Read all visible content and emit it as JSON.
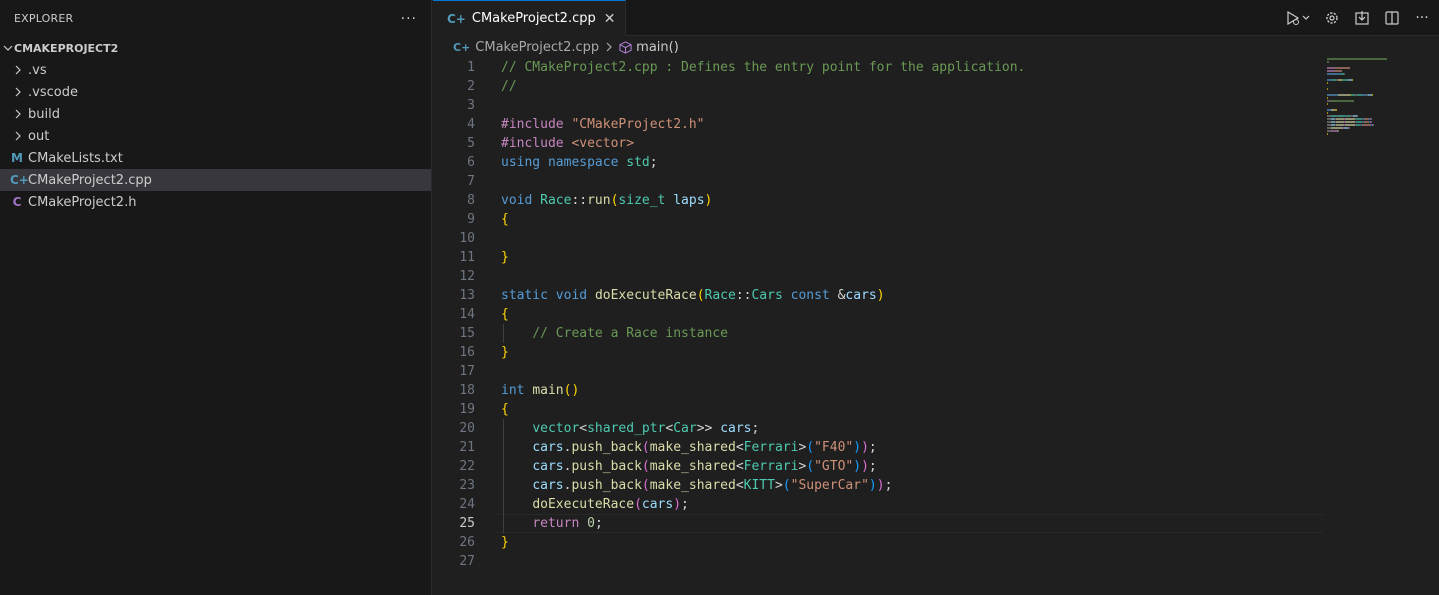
{
  "explorer": {
    "title": "EXPLORER",
    "more": "···",
    "project": "CMAKEPROJECT2",
    "items": [
      {
        "type": "folder",
        "label": ".vs"
      },
      {
        "type": "folder",
        "label": ".vscode"
      },
      {
        "type": "folder",
        "label": "build"
      },
      {
        "type": "folder",
        "label": "out"
      },
      {
        "type": "file",
        "icon": "M",
        "label": "CMakeLists.txt"
      },
      {
        "type": "file",
        "icon": "C+",
        "label": "CMakeProject2.cpp",
        "selected": true
      },
      {
        "type": "file",
        "icon": "C",
        "label": "CMakeProject2.h"
      }
    ]
  },
  "editor": {
    "tab": {
      "label": "CMakeProject2.cpp",
      "icon": "C+",
      "close": "✕"
    },
    "breadcrumb": {
      "file": "CMakeProject2.cpp",
      "symbol": "main()"
    },
    "current_line": 25,
    "lines": [
      [
        [
          "cm",
          "// CMakeProject2.cpp : Defines the entry point for the application."
        ]
      ],
      [
        [
          "cm",
          "//"
        ]
      ],
      [],
      [
        [
          "pp",
          "#include "
        ],
        [
          "st",
          "\"CMakeProject2.h\""
        ]
      ],
      [
        [
          "pp",
          "#include "
        ],
        [
          "st",
          "<vector>"
        ]
      ],
      [
        [
          "kw",
          "using "
        ],
        [
          "kw",
          "namespace "
        ],
        [
          "ty",
          "std"
        ],
        [
          "op",
          ";"
        ]
      ],
      [],
      [
        [
          "kw",
          "void "
        ],
        [
          "ty",
          "Race"
        ],
        [
          "op",
          "::"
        ],
        [
          "fn",
          "run"
        ],
        [
          "br1",
          "("
        ],
        [
          "ty",
          "size_t "
        ],
        [
          "va",
          "laps"
        ],
        [
          "br1",
          ")"
        ]
      ],
      [
        [
          "br1",
          "{"
        ]
      ],
      [],
      [
        [
          "br1",
          "}"
        ]
      ],
      [],
      [
        [
          "kw",
          "static "
        ],
        [
          "kw",
          "void "
        ],
        [
          "fn",
          "doExecuteRace"
        ],
        [
          "br1",
          "("
        ],
        [
          "ty",
          "Race"
        ],
        [
          "op",
          "::"
        ],
        [
          "ty",
          "Cars "
        ],
        [
          "kw",
          "const "
        ],
        [
          "op",
          "&"
        ],
        [
          "va",
          "cars"
        ],
        [
          "br1",
          ")"
        ]
      ],
      [
        [
          "br1",
          "{"
        ]
      ],
      [
        [
          "op",
          "    "
        ],
        [
          "cm",
          "// Create a Race instance"
        ]
      ],
      [
        [
          "br1",
          "}"
        ]
      ],
      [],
      [
        [
          "kw",
          "int "
        ],
        [
          "fn",
          "main"
        ],
        [
          "br1",
          "()"
        ]
      ],
      [
        [
          "br1",
          "{"
        ]
      ],
      [
        [
          "op",
          "    "
        ],
        [
          "ty",
          "vector"
        ],
        [
          "op",
          "<"
        ],
        [
          "ty",
          "shared_ptr"
        ],
        [
          "op",
          "<"
        ],
        [
          "ty",
          "Car"
        ],
        [
          "op",
          ">> "
        ],
        [
          "va",
          "cars"
        ],
        [
          "op",
          ";"
        ]
      ],
      [
        [
          "op",
          "    "
        ],
        [
          "va",
          "cars"
        ],
        [
          "op",
          "."
        ],
        [
          "fn",
          "push_back"
        ],
        [
          "br2",
          "("
        ],
        [
          "fn",
          "make_shared"
        ],
        [
          "op",
          "<"
        ],
        [
          "ty",
          "Ferrari"
        ],
        [
          "op",
          ">"
        ],
        [
          "br3",
          "("
        ],
        [
          "st",
          "\"F40\""
        ],
        [
          "br3",
          ")"
        ],
        [
          "br2",
          ")"
        ],
        [
          "op",
          ";"
        ]
      ],
      [
        [
          "op",
          "    "
        ],
        [
          "va",
          "cars"
        ],
        [
          "op",
          "."
        ],
        [
          "fn",
          "push_back"
        ],
        [
          "br2",
          "("
        ],
        [
          "fn",
          "make_shared"
        ],
        [
          "op",
          "<"
        ],
        [
          "ty",
          "Ferrari"
        ],
        [
          "op",
          ">"
        ],
        [
          "br3",
          "("
        ],
        [
          "st",
          "\"GTO\""
        ],
        [
          "br3",
          ")"
        ],
        [
          "br2",
          ")"
        ],
        [
          "op",
          ";"
        ]
      ],
      [
        [
          "op",
          "    "
        ],
        [
          "va",
          "cars"
        ],
        [
          "op",
          "."
        ],
        [
          "fn",
          "push_back"
        ],
        [
          "br2",
          "("
        ],
        [
          "fn",
          "make_shared"
        ],
        [
          "op",
          "<"
        ],
        [
          "ty",
          "KITT"
        ],
        [
          "op",
          ">"
        ],
        [
          "br3",
          "("
        ],
        [
          "st",
          "\"SuperCar\""
        ],
        [
          "br3",
          ")"
        ],
        [
          "br2",
          ")"
        ],
        [
          "op",
          ";"
        ]
      ],
      [
        [
          "op",
          "    "
        ],
        [
          "fn",
          "doExecuteRace"
        ],
        [
          "br2",
          "("
        ],
        [
          "va",
          "cars"
        ],
        [
          "br2",
          ")"
        ],
        [
          "op",
          ";"
        ]
      ],
      [
        [
          "op",
          "    "
        ],
        [
          "pp",
          "return "
        ],
        [
          "nu",
          "0"
        ],
        [
          "op",
          ";"
        ]
      ],
      [
        [
          "br1",
          "}"
        ]
      ],
      []
    ]
  },
  "colors": {
    "accent": "#0078d4",
    "comment": "#6a9955",
    "keyword": "#569cd6",
    "string": "#ce9178",
    "type": "#4ec9b0",
    "function": "#dcdcaa"
  }
}
